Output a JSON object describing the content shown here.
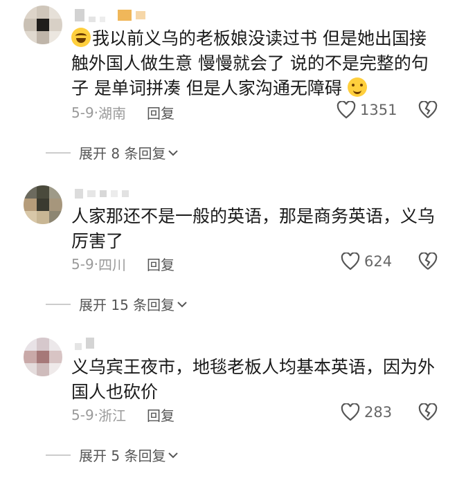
{
  "comments": [
    {
      "text": "我以前义乌的老板娘没读过书 但是她出国接触外国人做生意 慢慢就会了 说的不是完整的句子 是单词拼凑 但是人家沟通无障碍",
      "leading_emoji": "laughing-tears-icon",
      "trailing_emoji": "smile-icon",
      "date": "5-9",
      "region": "湖南",
      "reply_label": "回复",
      "likes": "1351",
      "expand_label": "展开 8 条回复"
    },
    {
      "text": "人家那还不是一般的英语，那是商务英语，义乌厉害了",
      "date": "5-9",
      "region": "四川",
      "reply_label": "回复",
      "likes": "624",
      "expand_label": "展开 15 条回复"
    },
    {
      "text": "义乌宾王夜市，地毯老板人均基本英语，因为外国人也砍价",
      "date": "5-9",
      "region": "浙江",
      "reply_label": "回复",
      "likes": "283",
      "expand_label": "展开 5 条回复"
    }
  ],
  "separator": "·"
}
